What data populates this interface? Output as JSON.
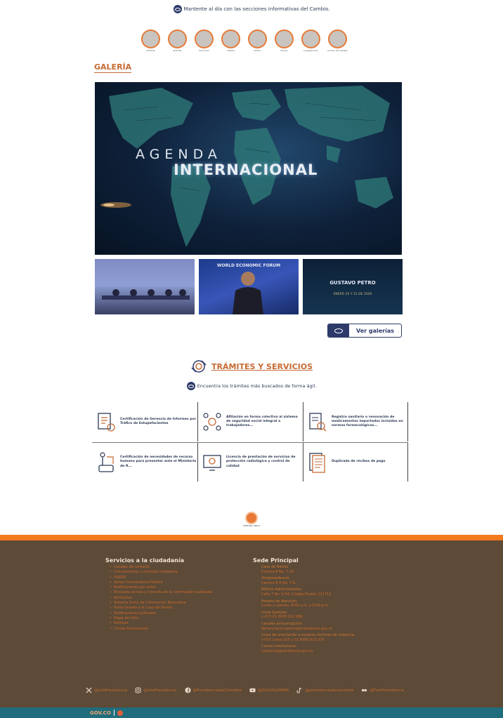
{
  "intro": {
    "text": "Mantente al día con las secciones informativas del Cambio."
  },
  "sections": [
    {
      "label": "Noticias"
    },
    {
      "label": "Podcast"
    },
    {
      "label": "Discursos"
    },
    {
      "label": "Galería"
    },
    {
      "label": "Videos"
    },
    {
      "label": "Prensa"
    },
    {
      "label": "Lenguaje Hoy"
    },
    {
      "label": "Archivo del Cambio"
    }
  ],
  "gallery": {
    "title": "GALERÍA",
    "hero": {
      "line1": "AGENDA",
      "line2": "INTERNACIONAL"
    },
    "thumbs": [
      {
        "caption": ""
      },
      {
        "caption": "WORLD ECONOMIC FORUM"
      },
      {
        "caption": "GUSTAVO PETRO",
        "sub": "ENERO 20 Y 21 DE 2026"
      }
    ],
    "button_label": "Ver galerías"
  },
  "tramites": {
    "title": "TRÁMITES Y SERVICIOS",
    "subtitle": "Encuentra los trámites más buscados de forma ágil.",
    "rows": [
      [
        {
          "text": "Certificación de Gerencia de Informes por Tráfico de Estupefacientes"
        },
        {
          "text": "Afiliación en forma colectiva al sistema de seguridad social integral a trabajadores..."
        },
        {
          "text": "Registro sanitario o renovación de medicamentos importados incluidos en normas farmacológicas..."
        }
      ],
      [
        {
          "text": "Certificación de necesidades de recurso humano para presentar ante el Ministerio de R..."
        },
        {
          "text": "Licencia de prestación de servicios de protección radiológica y control de calidad"
        },
        {
          "text": "Duplicado de recibos de pago"
        }
      ]
    ]
  },
  "seal": {
    "text": "VENTANA ÚNICA"
  },
  "footer": {
    "left_heading": "Servicios a la ciudadanía",
    "links": [
      "Canales de contacto",
      "Convocatorias y consulta ciudadana",
      "PQRSD",
      "Avisos Convocatoria Pública",
      "Notificaciones por aviso",
      "Encuesta acceso y consulta de la información publicada",
      "Normativa",
      "Sistema Único de Información Normativa",
      "Visita Guiada a la Casa de Nariño",
      "Notificaciones judiciales",
      "Mapa del Sitio",
      "Políticas",
      "Correo funcionarios"
    ],
    "right_heading": "Sede Principal",
    "blocks": [
      {
        "label": "Casa de Nariño",
        "value": "Carrera 8 No. 7-26."
      },
      {
        "label": "Vicepresidencia",
        "value": "Carrera 8 A No. 7-6."
      },
      {
        "label": "Edificio Administrativo:",
        "value": "Calle 7 No. 6-54. Código Postal: 111711"
      },
      {
        "label": "Horario de Atención:",
        "value": "Lunes a viernes, 8:00 a.m. a 5:00 p.m."
      },
      {
        "label": "Línea Gratuita:",
        "value": "(+57) 01 8000 913 666"
      },
      {
        "label": "Canales anticorrupción:",
        "value": "denunciacorrupcion@presidencia.gov.co"
      },
      {
        "label": "Línea de orientación a mujeres víctimas de violencia:",
        "value": "(+57) Línea 155 y 01 8000 913 370"
      },
      {
        "label": "Correo Institucional:",
        "value": "contacto@presidencia.gov.co"
      }
    ],
    "socials": [
      {
        "icon": "x-icon",
        "handle": "@infoPresidencia"
      },
      {
        "icon": "instagram-icon",
        "handle": "@infoPresidencia"
      },
      {
        "icon": "facebook-icon",
        "handle": "@PresidenciadeColombia"
      },
      {
        "icon": "youtube-icon",
        "handle": "@SIGCOLOMBIA"
      },
      {
        "icon": "tiktok-icon",
        "handle": "@presidenciadecolombia"
      },
      {
        "icon": "flickr-icon",
        "handle": "@FotoPresidencia"
      }
    ],
    "gov_logo": "GOV.CO"
  },
  "colors": {
    "accent": "#c66a33",
    "navy": "#2d3a6a",
    "footer_bg": "#5d4a37",
    "orange_bar": "#f27a1f",
    "bottom_bar": "#1f6d7d"
  }
}
